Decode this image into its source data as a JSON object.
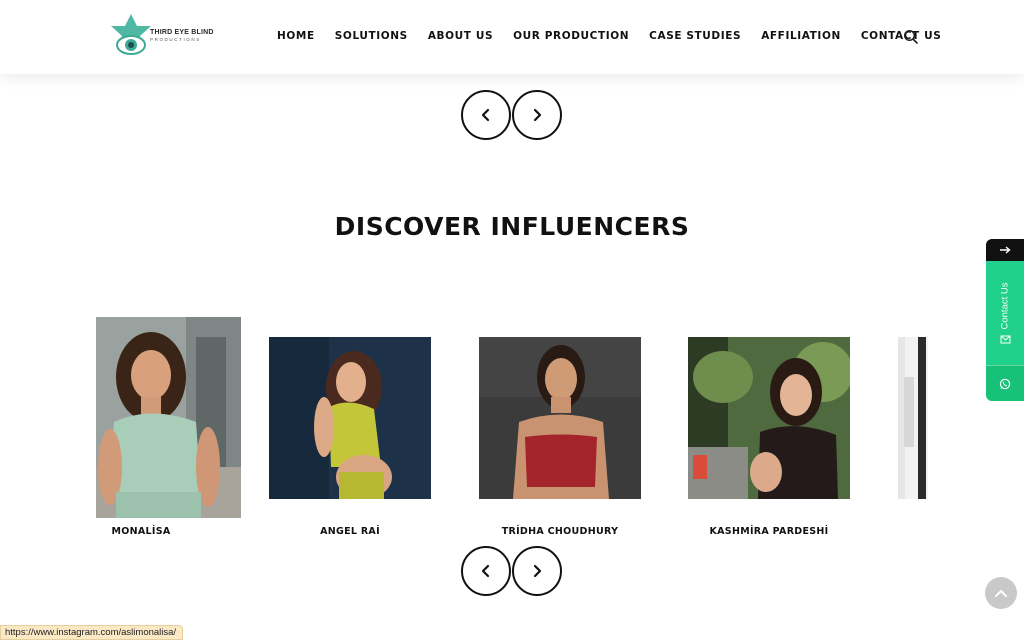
{
  "header": {
    "logo": {
      "line1": "THIRD EYE BLIND",
      "line2": "PRODUCTIONS"
    },
    "nav": [
      "HOME",
      "SOLUTIONS",
      "ABOUT US",
      "OUR PRODUCTION",
      "CASE STUDIES",
      "AFFILIATION",
      "CONTACT US"
    ],
    "search_icon": "search-icon"
  },
  "section": {
    "title": "DISCOVER INFLUENCERS"
  },
  "influencers": [
    {
      "name": "MONALİSA"
    },
    {
      "name": "ANGEL RAİ"
    },
    {
      "name": "TRİDHA CHOUDHURY"
    },
    {
      "name": "KASHMİRA PARDESHİ"
    }
  ],
  "side_widget": {
    "label": "Contact Us",
    "icons": [
      "arrow-right-icon",
      "mail-icon",
      "whatsapp-icon"
    ]
  },
  "status_bar": {
    "url": "https://www.instagram.com/aslimonalisa/"
  },
  "colors": {
    "accent_teal": "#3fb9a8",
    "widget_green": "#1fd18a",
    "status_bar_bg": "#fbe8c4"
  }
}
